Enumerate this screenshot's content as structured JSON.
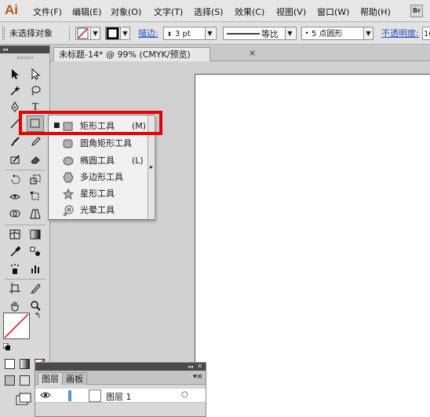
{
  "app": {
    "logo": "Ai",
    "bridge_label": "Br"
  },
  "menu": [
    {
      "label": "文件(F)"
    },
    {
      "label": "编辑(E)"
    },
    {
      "label": "对象(O)"
    },
    {
      "label": "文字(T)"
    },
    {
      "label": "选择(S)"
    },
    {
      "label": "效果(C)"
    },
    {
      "label": "视图(V)"
    },
    {
      "label": "窗口(W)"
    },
    {
      "label": "帮助(H)"
    }
  ],
  "control": {
    "selection_status": "未选择对象",
    "stroke_label": "描边:",
    "stroke_weight": "3 pt",
    "stroke_style": "等比",
    "brush_size": "5 点圆形",
    "opacity_label": "不透明度:",
    "opacity_value": "10"
  },
  "document": {
    "tab_title": "未标题-14* @ 99% (CMYK/预览)",
    "close_glyph": "×"
  },
  "toolbox": {
    "collapse_glyph": "◂◂"
  },
  "flyout": {
    "items": [
      {
        "label": "矩形工具",
        "shortcut": "(M)",
        "checked": true,
        "icon": "rectangle-icon"
      },
      {
        "label": "圆角矩形工具",
        "shortcut": "",
        "checked": false,
        "icon": "rounded-rectangle-icon"
      },
      {
        "label": "椭圆工具",
        "shortcut": "(L)",
        "checked": false,
        "icon": "ellipse-icon"
      },
      {
        "label": "多边形工具",
        "shortcut": "",
        "checked": false,
        "icon": "polygon-icon"
      },
      {
        "label": "星形工具",
        "shortcut": "",
        "checked": false,
        "icon": "star-icon"
      },
      {
        "label": "光晕工具",
        "shortcut": "",
        "checked": false,
        "icon": "flare-icon"
      }
    ],
    "check_glyph": "■",
    "tearoff_glyph": "▸"
  },
  "layers_panel": {
    "tab_layers": "图层",
    "tab_artboards": "画板",
    "collapse_glyph": "◂◂",
    "close_glyph": "✕",
    "menu_glyph": "▾≡",
    "layer_name": "图层 1",
    "target_glyph": "○"
  },
  "colors": {
    "highlight": "#e80000",
    "layer_color": "#5b8fd8",
    "logo": "#b35a1a"
  }
}
